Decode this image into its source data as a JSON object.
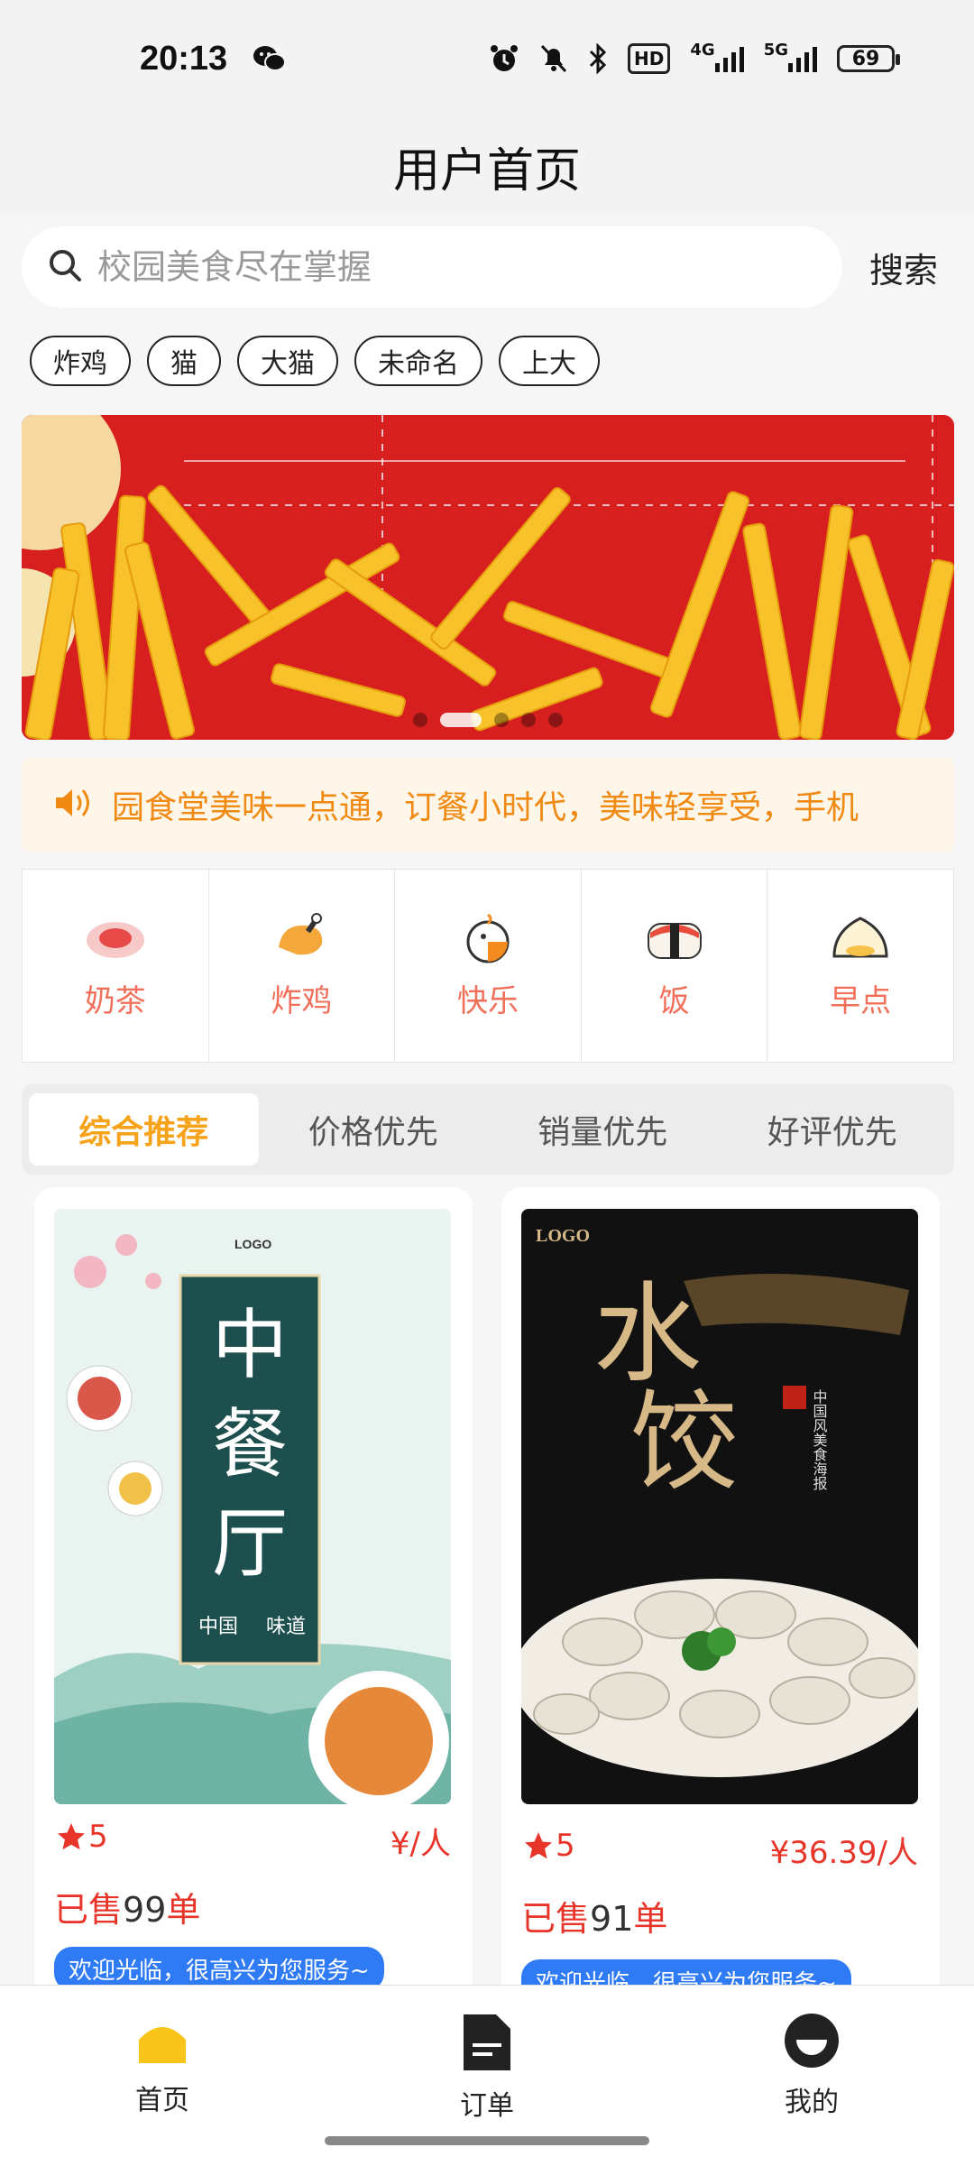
{
  "status_bar": {
    "time": "20:13",
    "app_icon": "wechat-icon",
    "icons": [
      "alarm-icon",
      "mute-bell-icon",
      "bluetooth-icon",
      "hd-icon",
      "signal-4g-icon",
      "signal-5g-icon"
    ],
    "hd_label": "HD",
    "net_4g": "4G",
    "net_5g": "5G",
    "battery": "69"
  },
  "header": {
    "title": "用户首页"
  },
  "search": {
    "placeholder": "校园美食尽在掌握",
    "button_label": "搜索"
  },
  "history_tags": [
    "炸鸡",
    "猫",
    "大猫",
    "未命名",
    "上大"
  ],
  "banner": {
    "slide_count": 5,
    "active_index": 1
  },
  "notice": {
    "text": "园食堂美味一点通，订餐小时代，美味轻享受，手机"
  },
  "categories": [
    {
      "label": "奶茶",
      "icon": "milk-tea-icon"
    },
    {
      "label": "炸鸡",
      "icon": "fried-chicken-icon"
    },
    {
      "label": "快乐",
      "icon": "happy-meal-icon"
    },
    {
      "label": "饭",
      "icon": "sushi-icon"
    },
    {
      "label": "早点",
      "icon": "bun-icon"
    }
  ],
  "sort_tabs": {
    "items": [
      "综合推荐",
      "价格优先",
      "销量优先",
      "好评优先"
    ],
    "active": 0
  },
  "products": [
    {
      "poster_title": "中餐厅",
      "poster_sub": "中国",
      "poster_sub2": "味道",
      "poster_logo": "LOGO",
      "rating": "5",
      "price": "¥/人",
      "sold_prefix": "已售",
      "sold_count": "99",
      "sold_suffix": "单",
      "welcome": "欢迎光临，很高兴为您服务~"
    },
    {
      "poster_title": "水饺",
      "poster_sub": "中国风美食海报",
      "poster_logo": "LOGO",
      "rating": "5",
      "price": "¥36.39/人",
      "sold_prefix": "已售",
      "sold_count": "91",
      "sold_suffix": "单",
      "welcome": "欢迎光临，很高兴为您服务~"
    }
  ],
  "bottom_nav": [
    {
      "label": "首页",
      "icon": "home-icon",
      "color": "#f8c419"
    },
    {
      "label": "订单",
      "icon": "order-document-icon",
      "color": "#222222"
    },
    {
      "label": "我的",
      "icon": "profile-icon",
      "color": "#222222"
    }
  ],
  "colors": {
    "accent_orange": "#f7a31a",
    "price_red": "#e8352a",
    "welcome_blue": "#2f7bf5"
  }
}
